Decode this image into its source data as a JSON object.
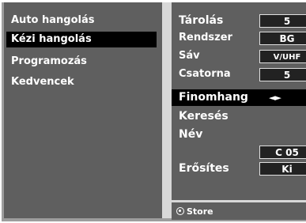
{
  "left_menu": {
    "items": [
      {
        "label": "Auto hangolás"
      },
      {
        "label": "Kézi hangolás"
      },
      {
        "label": "Programozás"
      },
      {
        "label": "Kedvencek"
      }
    ]
  },
  "settings": {
    "storage_label": "Tárolás",
    "storage_value": "5",
    "system_label": "Rendszer",
    "system_value": "BG",
    "band_label": "Sáv",
    "band_value": "V/UHF",
    "channel_label": "Csatorna",
    "channel_value": "5",
    "fine_tune_label": "Finomhang",
    "fine_tune_arrows": "◄►",
    "search_label": "Keresés",
    "name_label": "Név",
    "name_value": "C 05",
    "booster_label": "Erősítes",
    "booster_value": "Ki"
  },
  "footer": {
    "store_label": "Store"
  },
  "colors": {
    "panel": "#5f5f5f",
    "selection": "#000000",
    "divider": "#d8d8d8",
    "text": "#ffffff"
  }
}
